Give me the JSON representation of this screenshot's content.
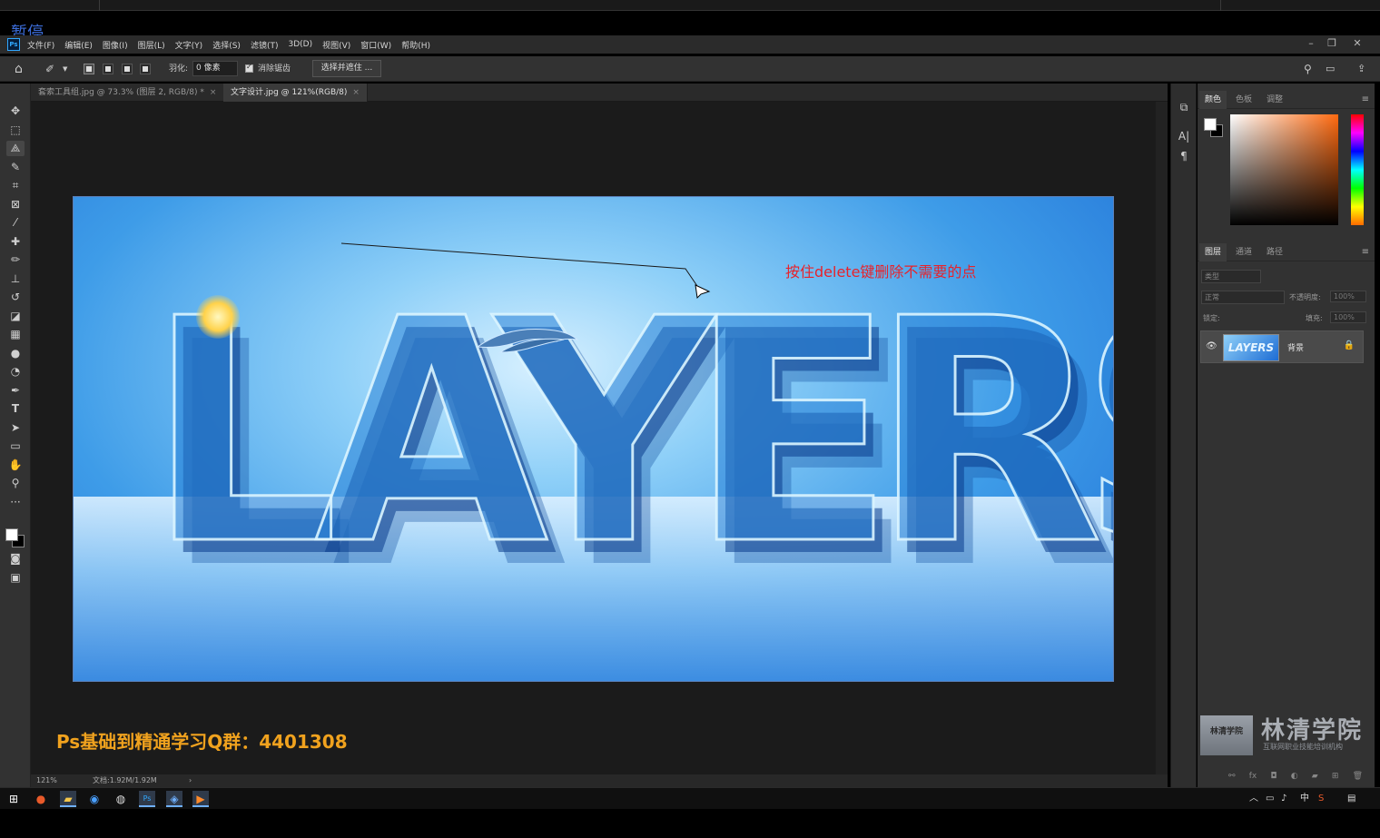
{
  "overlay": {
    "pause_label": "暂停"
  },
  "menu": {
    "logo": "Ps",
    "items": [
      "文件(F)",
      "编辑(E)",
      "图像(I)",
      "图层(L)",
      "文字(Y)",
      "选择(S)",
      "滤镜(T)",
      "3D(D)",
      "视图(V)",
      "窗口(W)",
      "帮助(H)"
    ],
    "window_controls": [
      "–",
      "❐",
      "✕"
    ]
  },
  "options": {
    "feather_label": "羽化:",
    "feather_value": "0 像素",
    "antialias_label": "消除锯齿",
    "select_mask_label": "选择并遮住 ..."
  },
  "tabs": [
    {
      "label": "套索工具组.jpg @ 73.3% (图层 2, RGB/8) *",
      "active": false
    },
    {
      "label": "文字设计.jpg @ 121%(RGB/8)",
      "active": true
    }
  ],
  "tab_close": "×",
  "canvas": {
    "image_text": "LAYERS",
    "annotation": "按住delete键删除不需要的点",
    "promo": "Ps基础到精通学习Q群：4401308"
  },
  "status": {
    "zoom": "121%",
    "doc": "文档:1.92M/1.92M",
    "arrow": "›"
  },
  "color_panel": {
    "tabs": [
      "颜色",
      "色板",
      "调整"
    ],
    "fg_color": "#ffffff",
    "bg_color": "#000000"
  },
  "layers_panel": {
    "tabs": [
      "图层",
      "通道",
      "路径"
    ],
    "search_placeholder": "类型",
    "blend_mode": "正常",
    "opacity_label": "不透明度:",
    "opacity_value": "100%",
    "lock_label": "锁定:",
    "fill_label": "填充:",
    "fill_value": "100%",
    "layer": {
      "name": "背景",
      "thumb_text": "LAYERS"
    }
  },
  "watermark": {
    "logo_text": "林清学院",
    "name": "林清学院",
    "sub": "互联网职业技能培训机构"
  },
  "taskbar": {
    "ime": "中"
  },
  "colors": {
    "accent": "#31a8ff",
    "annotation": "#e8222a",
    "promo": "#f0a21e",
    "pause": "#3b6bd6"
  }
}
